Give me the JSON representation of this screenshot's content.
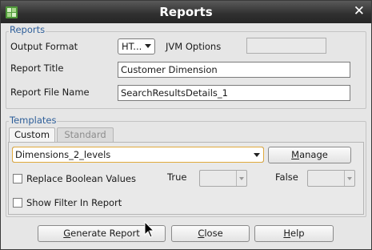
{
  "window": {
    "title": "Reports",
    "app_icon": "oracle-sqldev-icon",
    "close_icon": "close-icon"
  },
  "reports_group": {
    "label": "Reports",
    "output_format_label": "Output Format",
    "output_format_value": "HT...",
    "jvm_options_label": "JVM Options",
    "jvm_options_value": "",
    "report_title_label": "Report Title",
    "report_title_value": "Customer Dimension",
    "report_file_name_label": "Report File Name",
    "report_file_name_value": "SearchResultsDetails_1"
  },
  "templates_group": {
    "label": "Templates",
    "tabs": [
      {
        "label": "Custom",
        "active": true
      },
      {
        "label": "Standard",
        "active": false
      }
    ],
    "template_value": "Dimensions_2_levels",
    "manage_button": {
      "label": "Manage",
      "mnemonic": "M",
      "rest": "anage"
    },
    "replace_boolean_label": "Replace Boolean Values",
    "true_label": "True",
    "false_label": "False",
    "show_filter_label": "Show Filter In Report"
  },
  "buttons": {
    "generate": {
      "label": "Generate Report",
      "mnemonic": "G",
      "rest": "enerate Report"
    },
    "close": {
      "label": "Close",
      "mnemonic": "C",
      "rest": "lose"
    },
    "help": {
      "label": "Help",
      "mnemonic": "H",
      "rest": "elp"
    }
  }
}
